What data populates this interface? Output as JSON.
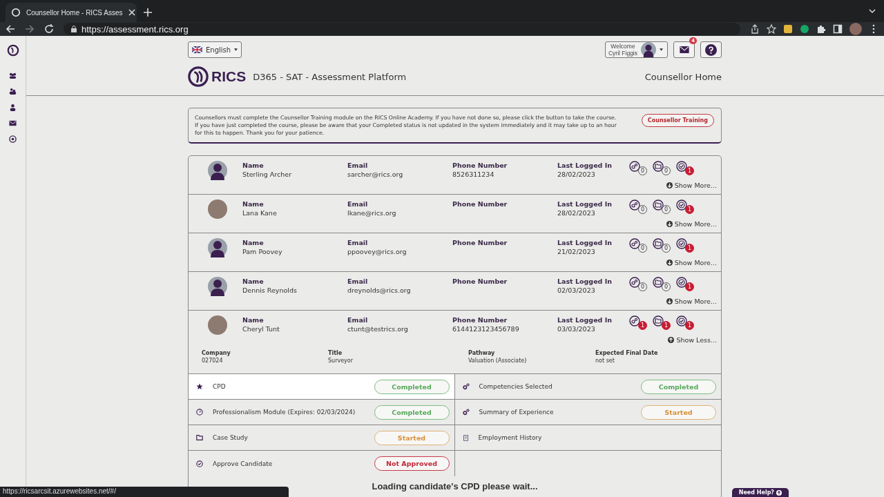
{
  "browser": {
    "tab_title": "Counsellor Home - RICS Asses",
    "url": "https://assessment.rics.org",
    "status_url": "https://ricsarcsit.azurewebsites.net/#/"
  },
  "language": {
    "label": "English"
  },
  "user": {
    "welcome": "Welcome",
    "name": "Cyril Figgis"
  },
  "messages": {
    "count": "4"
  },
  "brand": {
    "logo_text": "RICS",
    "platform": "D365 - SAT - Assessment Platform"
  },
  "page_title": "Counsellor Home",
  "notice": {
    "text": "Counsellors must complete the Counsellor Training module on the RICS Online Academy. If you have not done so, please click the button to take the course. If you have just completed the course, please be aware that your Completed status is not updated in the system immediately and it may take up to an hour for this to happen. Thank you for your patience.",
    "button": "Counsellor Training"
  },
  "candidates": [
    {
      "labels": {
        "name": "Name",
        "email": "Email",
        "phone": "Phone Number",
        "last_login": "Last Logged In"
      },
      "name": "Sterling Archer",
      "email": "sarcher@rics.org",
      "phone": "8526311234",
      "last_login": "28/02/2023",
      "photo": false,
      "badges": [
        {
          "count": "0",
          "alert": false
        },
        {
          "count": "0",
          "alert": false
        },
        {
          "count": "1",
          "alert": true
        }
      ],
      "toggle": "Show More...",
      "expanded": false
    },
    {
      "labels": {
        "name": "Name",
        "email": "Email",
        "phone": "Phone Number",
        "last_login": "Last Logged In"
      },
      "name": "Lana Kane",
      "email": "lkane@rics.org",
      "last_login": "28/02/2023",
      "photo": true,
      "badges": [
        {
          "count": "0",
          "alert": false
        },
        {
          "count": "0",
          "alert": false
        },
        {
          "count": "1",
          "alert": true
        }
      ],
      "toggle": "Show More...",
      "expanded": false
    },
    {
      "labels": {
        "name": "Name",
        "email": "Email",
        "phone": "Phone Number",
        "last_login": "Last Logged In"
      },
      "name": "Pam Poovey",
      "email": "ppoovey@rics.org",
      "last_login": "21/02/2023",
      "photo": false,
      "badges": [
        {
          "count": "0",
          "alert": false
        },
        {
          "count": "0",
          "alert": false
        },
        {
          "count": "1",
          "alert": true
        }
      ],
      "toggle": "Show More...",
      "expanded": false
    },
    {
      "labels": {
        "name": "Name",
        "email": "Email",
        "phone": "Phone Number",
        "last_login": "Last Logged In"
      },
      "name": "Dennis Reynolds",
      "email": "dreynolds@rics.org",
      "last_login": "02/03/2023",
      "photo": false,
      "badges": [
        {
          "count": "0",
          "alert": false
        },
        {
          "count": "0",
          "alert": false
        },
        {
          "count": "1",
          "alert": true
        }
      ],
      "toggle": "Show More...",
      "expanded": false
    },
    {
      "labels": {
        "name": "Name",
        "email": "Email",
        "phone": "Phone Number",
        "last_login": "Last Logged In"
      },
      "name": "Cheryl Tunt",
      "email": "ctunt@testrics.org",
      "phone": "6144123123456789",
      "last_login": "03/03/2023",
      "photo": true,
      "badges": [
        {
          "count": "1",
          "alert": true
        },
        {
          "count": "1",
          "alert": true
        },
        {
          "count": "1",
          "alert": true
        }
      ],
      "toggle": "Show Less...",
      "expanded": true,
      "details": [
        {
          "label": "Company",
          "value": "027024"
        },
        {
          "label": "Title",
          "value": "Surveyor"
        },
        {
          "label": "Pathway",
          "value": "Valuation (Associate)"
        },
        {
          "label": "Expected Final Date",
          "value": "not set"
        }
      ]
    }
  ],
  "sections": [
    {
      "label": "CPD",
      "kind": "star",
      "highlighted": true,
      "status": {
        "label": "Completed",
        "kind": "completed"
      }
    },
    {
      "label": "Competencies Selected",
      "kind": "gears",
      "highlighted": false,
      "status": {
        "label": "Completed",
        "kind": "completed"
      }
    },
    {
      "label": "Professionalism Module (Expires: 02/03/2024)",
      "kind": "clock",
      "highlighted": false,
      "status": {
        "label": "Completed",
        "kind": "completed"
      }
    },
    {
      "label": "Summary of Experience",
      "kind": "gears",
      "highlighted": false,
      "status": {
        "label": "Started",
        "kind": "started"
      }
    },
    {
      "label": "Case Study",
      "kind": "folder",
      "highlighted": false,
      "status": {
        "label": "Started",
        "kind": "started"
      }
    },
    {
      "label": "Employment History",
      "kind": "building",
      "highlighted": false
    },
    {
      "label": "Approve Candidate",
      "kind": "check",
      "highlighted": false,
      "status": {
        "label": "Not Approved",
        "kind": "not_approved"
      }
    }
  ],
  "loading": "Loading candidate's CPD please wait...",
  "help": {
    "label": "Need Help?"
  }
}
